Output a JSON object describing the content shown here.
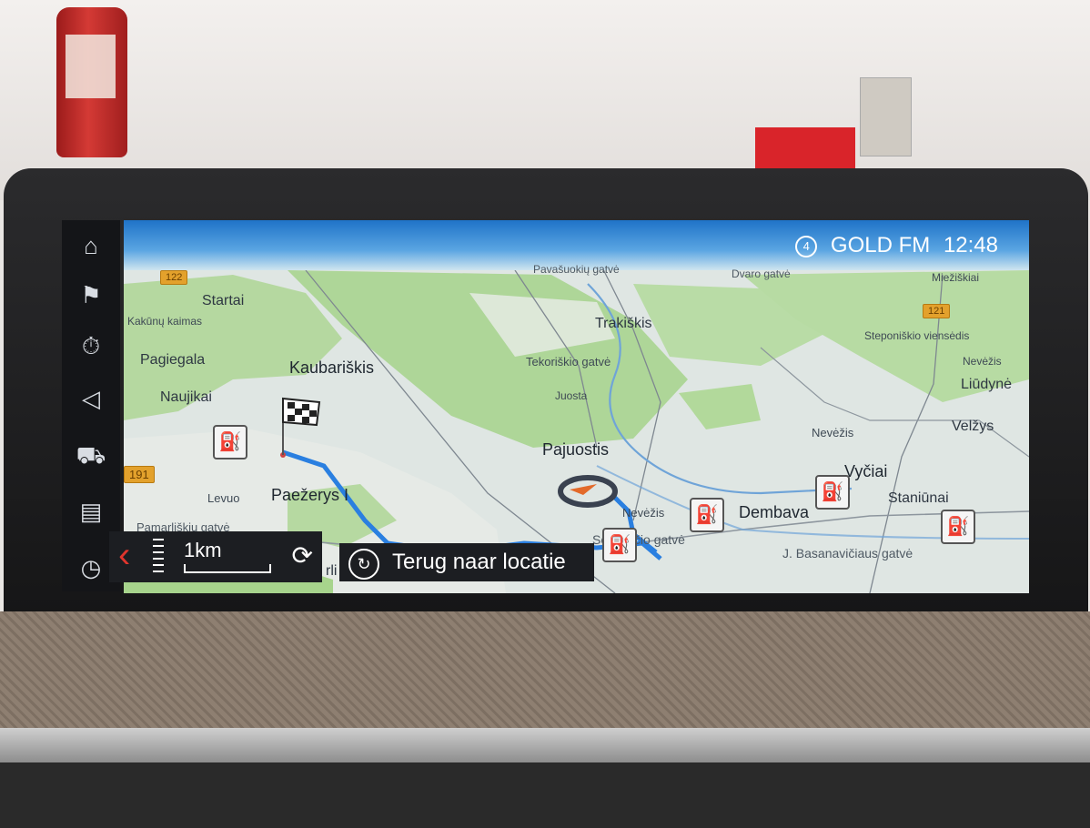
{
  "status": {
    "radio_station": "GOLD FM",
    "time": "12:48",
    "station_badge": "4"
  },
  "sidebar": {
    "items": [
      {
        "icon": "home-icon"
      },
      {
        "icon": "checkered-flag-icon"
      },
      {
        "icon": "stopwatch-icon"
      },
      {
        "icon": "volume-icon"
      },
      {
        "icon": "car-icon"
      },
      {
        "icon": "map-icon"
      },
      {
        "icon": "compass-icon"
      }
    ]
  },
  "map": {
    "places": [
      "Startai",
      "Kakūnų kaimas",
      "Pagiegala",
      "Kaubariškis",
      "Naujikai",
      "Paežerys I",
      "Levuo",
      "Trakiškis",
      "Tekoriškio gatvė",
      "Juosta",
      "Pajuostis",
      "Nevėžis",
      "Dembava",
      "Vyčiai",
      "Staniūnai",
      "Liūdynė",
      "Velžys",
      "Nevėžis",
      "Steponiškio viensėdis",
      "Miežiškiai",
      "Pavašuokių gatvė",
      "Dvaro gatvė",
      "Pamarliškių gatvė",
      "J. Basanavičiaus gatvė",
      "Sestiesčio gatvė",
      "Nevėžis",
      "rli"
    ],
    "route_shields": [
      "122",
      "121",
      "191"
    ]
  },
  "hud": {
    "scale": "1km"
  },
  "recenter": {
    "label": "Terug naar locatie"
  },
  "colors": {
    "route": "#2a7fe0",
    "accent_red": "#e0352d",
    "topbar": "#1f73c8"
  }
}
